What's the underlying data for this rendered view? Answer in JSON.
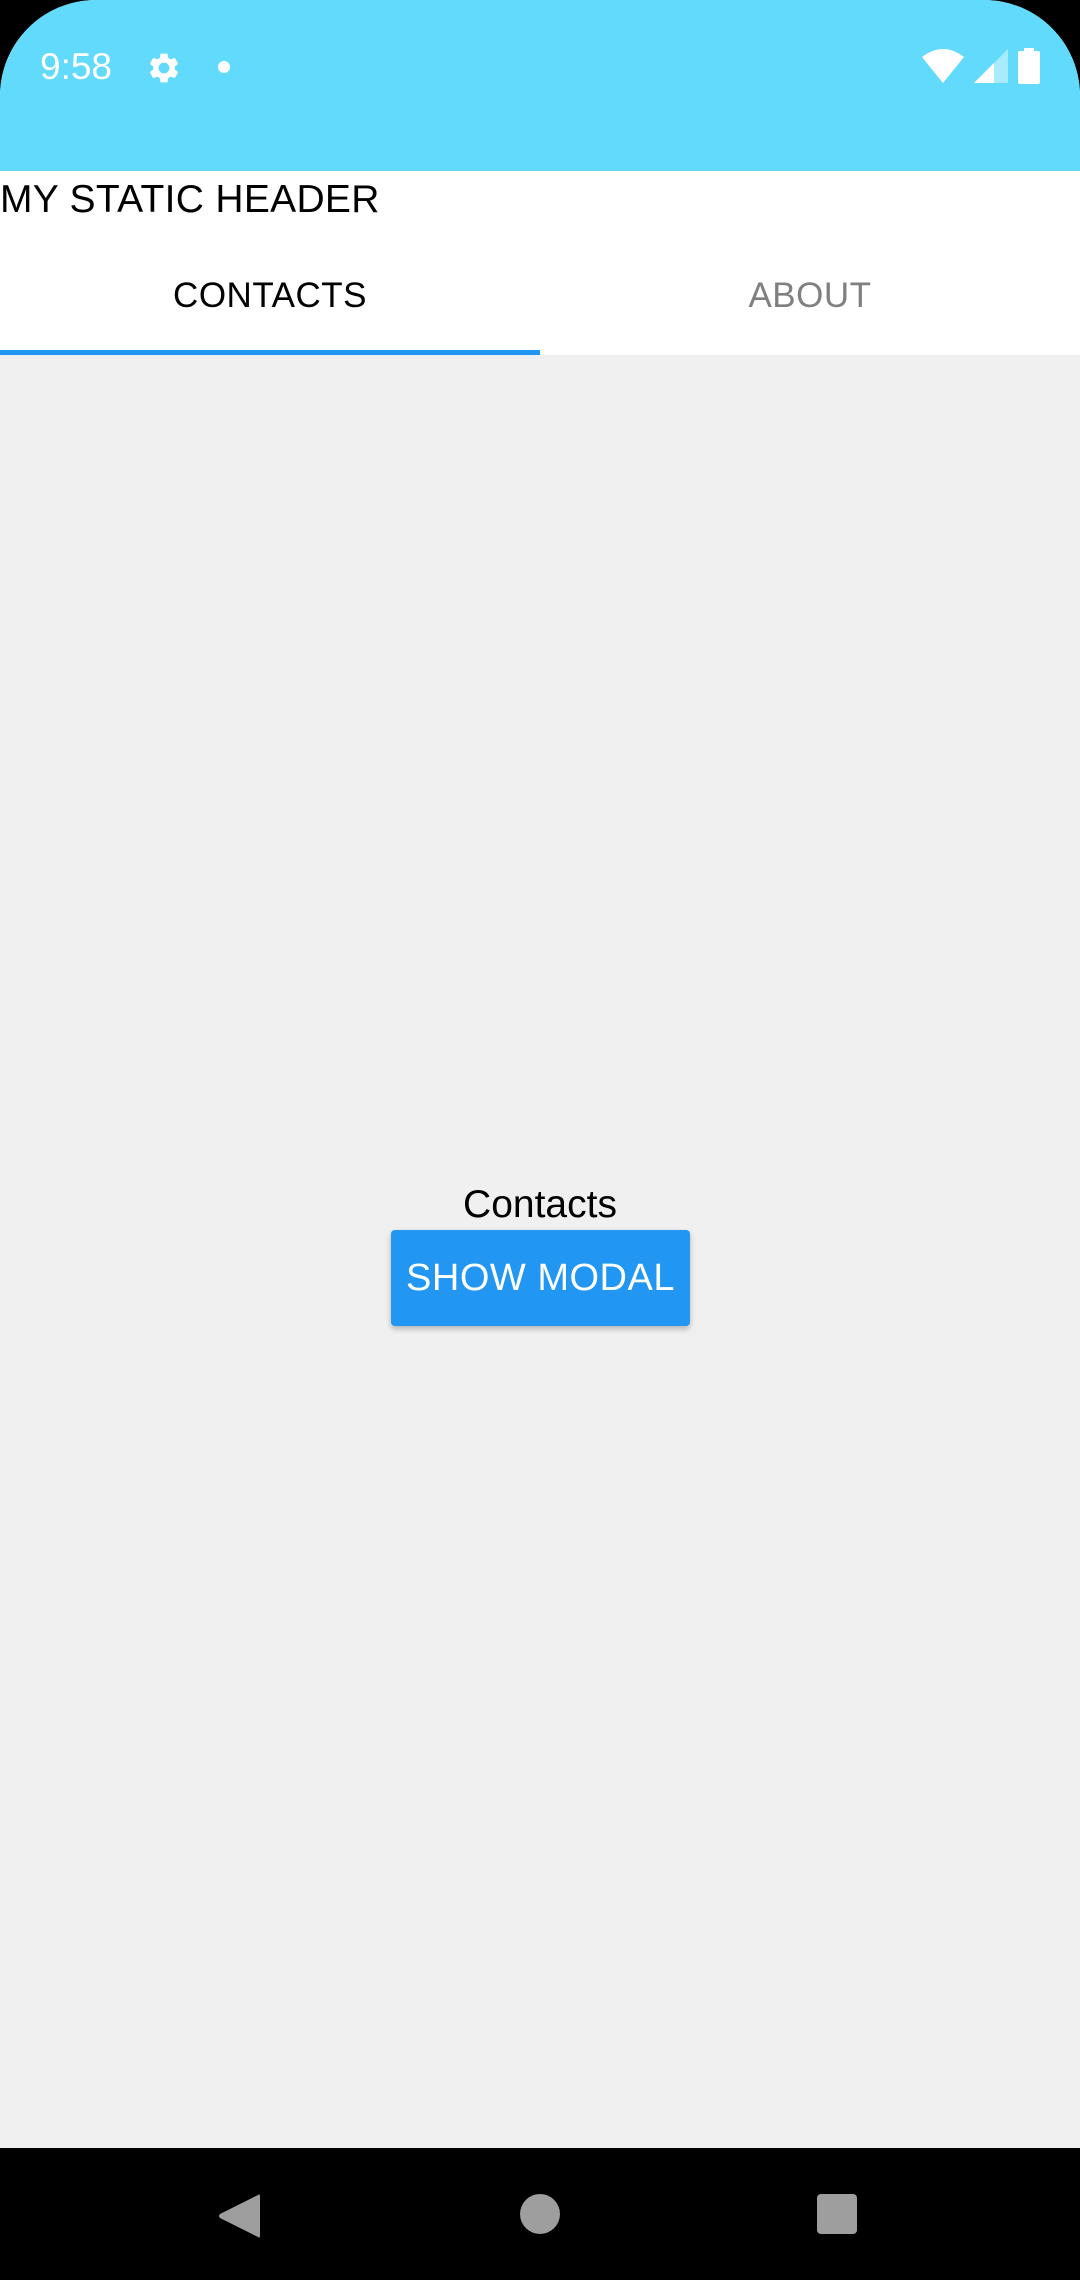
{
  "status_bar": {
    "time": "9:58",
    "background_color": "#62dafc",
    "icons": [
      "gear-icon",
      "notification-dot-icon",
      "wifi-icon",
      "cellular-signal-icon",
      "battery-icon"
    ]
  },
  "header": {
    "title": "MY STATIC HEADER"
  },
  "tabs": [
    {
      "label": "CONTACTS",
      "selected": true
    },
    {
      "label": "ABOUT",
      "selected": false
    }
  ],
  "tab_indicator_color": "#2196f3",
  "content": {
    "title": "Contacts",
    "button_label": "SHOW MODAL",
    "button_color": "#2196f3",
    "background_color": "#f0f0f0"
  },
  "nav_bar": {
    "icons": [
      "back-icon",
      "home-icon",
      "recents-icon"
    ]
  }
}
